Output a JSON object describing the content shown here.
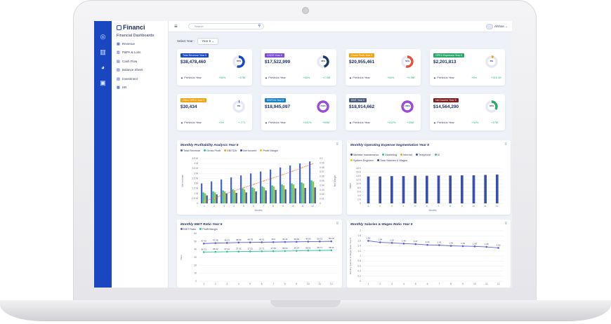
{
  "brand": {
    "name": "Financi"
  },
  "nav": {
    "title": "Financial Dashboards",
    "items": [
      {
        "label": "Revenue",
        "icon": "grid-icon"
      },
      {
        "label": "P&PA & Loss",
        "icon": "bar-icon"
      },
      {
        "label": "Cash Flow",
        "icon": "list-icon"
      },
      {
        "label": "Balance Sheet",
        "icon": "sheet-icon"
      },
      {
        "label": "Investment",
        "icon": "invest-icon"
      },
      {
        "label": "HR",
        "icon": "users-icon"
      }
    ]
  },
  "topbar": {
    "search_placeholder": "Search",
    "user_name": "Afshan"
  },
  "filter": {
    "label": "Select Year :",
    "value": "Year 5"
  },
  "kpis": [
    {
      "tag": "Total Revenue Year 5",
      "tag_color": "#1b46c2",
      "value": "$38,478,460",
      "prev_label": "Previous Year",
      "pct": "+56%",
      "change": "+17M",
      "gauge_pct": 0.55,
      "gauge_color": "#1b46c2",
      "gauge_text": "55%"
    },
    {
      "tag": "COGS Year 5",
      "tag_color": "#7a4ad9",
      "value": "$17,522,999",
      "prev_label": "Previous Year",
      "pct": "+46%",
      "change": "+7.0M",
      "gauge_pct": 0.46,
      "gauge_color": "#1b3a6b",
      "gauge_text": "46%"
    },
    {
      "tag": "Gross Profit Year 5",
      "tag_color": "#f0a313",
      "value": "$20,955,461",
      "prev_label": "Previous Year",
      "pct": "+54%",
      "change": "+9.3M",
      "gauge_pct": 0.54,
      "gauge_color": "#e8503a",
      "gauge_text": "54%"
    },
    {
      "tag": "OPEX Expenses Year 5",
      "tag_color": "#2aa86a",
      "value": "$2,201,813",
      "prev_label": "Previous Year",
      "pct": "+6%",
      "change": "+316.3K",
      "gauge_pct": 0.06,
      "gauge_color": "#f0a313",
      "gauge_text": "6%"
    },
    {
      "tag": "Other OPEX Year 5",
      "tag_color": "#f0a313",
      "value": "$30,434",
      "prev_label": "Previous Year",
      "pct": "+0%",
      "change": "+-771",
      "gauge_pct": 0.0,
      "gauge_color": "#1b46c2",
      "gauge_text": "0%"
    },
    {
      "tag": "EBITDA Year 5",
      "tag_color": "#1b7fc2",
      "value": "$18,945,097",
      "prev_label": "Previous Year",
      "pct": "+151%",
      "change": "+59M",
      "gauge_pct": 1.0,
      "gauge_color": "#9b4ad9",
      "gauge_text": "151%"
    },
    {
      "tag": "EBIT Year 5",
      "tag_color": "#4a5a7a",
      "value": "$18,914,662",
      "prev_label": "Previous Year",
      "pct": "+152%",
      "change": "+33M",
      "gauge_pct": 1.0,
      "gauge_color": "#9b4ad9",
      "gauge_text": "152%"
    },
    {
      "tag": "Net Income Year 5",
      "tag_color": "#7a1f1f",
      "value": "$14,564,290",
      "prev_label": "Previous Year",
      "pct": "+34%",
      "change": "+17M",
      "gauge_pct": 0.34,
      "gauge_color": "#2aa86a",
      "gauge_text": "34%"
    }
  ],
  "charts": {
    "profit": {
      "title": "Monthly Profitability Analysis Year 5",
      "legend": [
        {
          "name": "Total Revenue",
          "color": "#4a66c2"
        },
        {
          "name": "Gross Profit",
          "color": "#2fc29a"
        },
        {
          "name": "EBITDA",
          "color": "#f0a313"
        },
        {
          "name": "Net Income",
          "color": "#3a4fb0"
        },
        {
          "name": "Profit Margin",
          "color": "#f0c419"
        }
      ],
      "xlabel": "Months",
      "ylabel": "Net Income",
      "y2label": "Net Margin"
    },
    "opex": {
      "title": "Monthly Operating Expense Segmentation Year 5",
      "legend_row1": [
        {
          "name": "Website maintenance",
          "color": "#3a4fb0"
        },
        {
          "name": "Marketing",
          "color": "#2fc29a"
        },
        {
          "name": "Internet",
          "color": "#f0a313"
        },
        {
          "name": "Telephone",
          "color": "#3a4fb0"
        },
        {
          "name": "UI",
          "color": "#2fc29a"
        }
      ],
      "legend_row2": [
        {
          "name": "System Engineer",
          "color": "#f0c419"
        },
        {
          "name": "Total Salaries & Wages",
          "color": "#3a4fb0"
        }
      ],
      "xlabel": "Months",
      "ylabel": "Value"
    },
    "ebit": {
      "title": "Monthly EBIT Ratio Year 5",
      "legend": [
        {
          "name": "EBIT Ratio",
          "color": "#5a5fd6"
        },
        {
          "name": "Profit Margin",
          "color": "#2fc29a"
        }
      ],
      "ylabel": "Ratio"
    },
    "salaries": {
      "title": "Monthly Salaries & Wages Ratio Year 5",
      "ylabel": "Monthly Salaries & Wages Ratio Year 5"
    }
  },
  "chart_data": [
    {
      "type": "bar",
      "title": "Monthly Profitability Analysis Year 5",
      "categories": [
        "1",
        "2",
        "3",
        "4",
        "5",
        "6",
        "7",
        "8",
        "9",
        "10",
        "11",
        "12"
      ],
      "xlabel": "Months",
      "ylabel": "Net Income",
      "y2label": "Net Margin",
      "ylim": [
        0,
        4.5
      ],
      "yticks": [
        "4.5 M",
        "4 M",
        "3.5 M",
        "3 M",
        "2.5 M",
        "2 M",
        "1.5 M",
        "1 M",
        "0.5 M",
        "0"
      ],
      "y2ticks": [
        "0.1",
        "0.09",
        "0.08",
        "0.07",
        "0.06",
        "0.05",
        "0.04",
        "0.03",
        "0.02",
        "0.01",
        "0"
      ],
      "series": [
        {
          "name": "Total Revenue",
          "values": [
            2.0,
            2.2,
            2.4,
            2.6,
            2.8,
            3.0,
            3.2,
            3.4,
            3.6,
            3.8,
            4.0,
            4.2
          ]
        },
        {
          "name": "Gross Profit",
          "values": [
            1.1,
            1.2,
            1.3,
            1.4,
            1.5,
            1.6,
            1.7,
            1.8,
            1.9,
            2.0,
            2.1,
            2.3
          ]
        },
        {
          "name": "EBITDA",
          "values": [
            1.0,
            1.1,
            1.2,
            1.3,
            1.4,
            1.5,
            1.6,
            1.7,
            1.8,
            1.9,
            2.0,
            2.2
          ]
        },
        {
          "name": "Net Income",
          "values": [
            0.8,
            0.9,
            1.0,
            1.05,
            1.1,
            1.2,
            1.3,
            1.35,
            1.4,
            1.5,
            1.55,
            1.6
          ]
        },
        {
          "name": "Profit Margin",
          "values": [
            0.005,
            0.012,
            0.02,
            0.028,
            0.035,
            0.042,
            0.05,
            0.057,
            0.064,
            0.072,
            0.08,
            0.088
          ]
        }
      ]
    },
    {
      "type": "bar",
      "title": "Monthly Operating Expense Segmentation Year 5",
      "categories": [
        "1",
        "2",
        "3",
        "4",
        "5",
        "6",
        "7",
        "8",
        "9",
        "10",
        "11",
        "12"
      ],
      "xlabel": "Months",
      "ylabel": "Value",
      "ylim": [
        0,
        18
      ],
      "yticks": [
        "18 K",
        "16 K",
        "14 K",
        "12 K",
        "10 K",
        "8 K",
        "6 K",
        "4 K",
        "2 K",
        "0"
      ],
      "series": [
        {
          "name": "Total Salaries & Wages",
          "values": [
            13.8,
            13.8,
            14.0,
            14.0,
            14.2,
            14.2,
            14.3,
            14.3,
            14.4,
            14.4,
            14.6,
            14.8
          ]
        }
      ]
    },
    {
      "type": "line",
      "title": "Monthly EBIT Ratio Year 5",
      "categories": [
        "1",
        "2",
        "3",
        "4",
        "5",
        "6",
        "7",
        "8",
        "9",
        "10",
        "11",
        "12"
      ],
      "ylabel": "Ratio",
      "ylim": [
        0,
        60
      ],
      "yticks": [
        "60",
        "50",
        "40",
        "30",
        "20",
        "10",
        "0"
      ],
      "series": [
        {
          "name": "EBIT Ratio",
          "values": [
            47.42,
            47.98,
            48.23,
            48.66,
            48.78,
            49.01,
            49.2,
            49.41,
            49.59,
            49.82,
            50.01,
            50.18
          ],
          "labels": [
            "47.42",
            "47.98",
            "48.23",
            "48.66",
            "48.78",
            "49.01",
            "49.2",
            "49.41",
            "49.59",
            "49.82",
            "50.01",
            "50.18"
          ]
        },
        {
          "name": "Profit Margin",
          "values": [
            36.71,
            36.92,
            37.12,
            37.32,
            37.52,
            37.71,
            37.84,
            38.04,
            38.24,
            38.51,
            38.71,
            38.94
          ],
          "labels": [
            "36.71",
            "36.92",
            "37.12",
            "37.32",
            "37.52",
            "37.71",
            "37.84",
            "38.04",
            "38.24",
            "38.51",
            "38.71",
            "38.94"
          ]
        }
      ]
    },
    {
      "type": "line",
      "title": "Monthly Salaries & Wages Ratio Year 5",
      "categories": [
        "1",
        "2",
        "3",
        "4",
        "5",
        "6",
        "7",
        "8",
        "9",
        "10",
        "11",
        "12"
      ],
      "ylabel": "Monthly Salaries & Wages Ratio Year 5",
      "ylim": [
        0,
        2
      ],
      "yticks": [
        "2",
        "1.8",
        "1.6",
        "1.4",
        "1.2",
        "1",
        "0.8",
        "0.6",
        "0.4",
        "0.2",
        "0"
      ],
      "series": [
        {
          "name": "Salaries & Wages Ratio",
          "values": [
            1.6,
            1.54,
            1.52,
            1.49,
            1.47,
            1.44,
            1.43,
            1.4,
            1.39,
            1.38,
            1.36,
            1.32
          ],
          "labels": [
            "1.60",
            "1.54",
            "1.52",
            "1.49",
            "1.47",
            "1.44",
            "1.43",
            "1.40",
            "1.39",
            "1.38",
            "1.36",
            "1.32"
          ]
        }
      ]
    }
  ]
}
